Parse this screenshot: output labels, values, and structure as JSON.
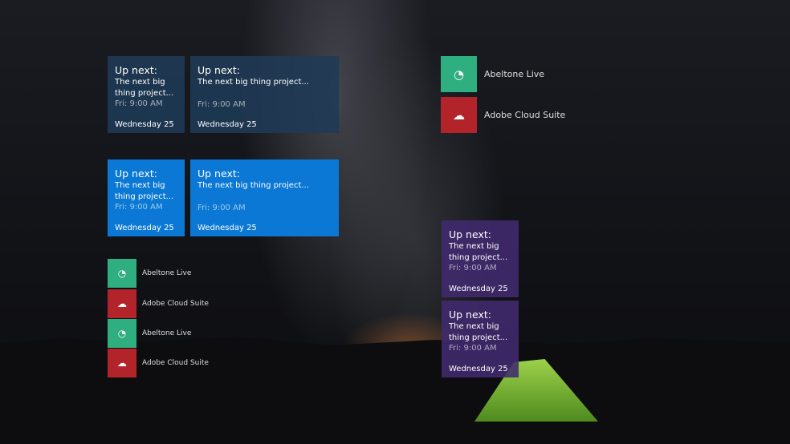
{
  "tiles": [
    {
      "heading": "Up next:",
      "subject": "The next big thing project...",
      "time": "Fri: 9:00 AM",
      "date": "Wednesday 25"
    }
  ],
  "apps": {
    "ableton": "Abeltone Live",
    "adobe": "Adobe Cloud Suite"
  },
  "icons": {
    "ableton": "ableton-live-icon",
    "adobe": "creative-cloud-icon"
  },
  "colors": {
    "dark_tile": "#1f3a57",
    "blue_tile": "#0a78d4",
    "purple_tile": "#402a6e",
    "green": "#2fae7f",
    "red": "#b3232a"
  }
}
